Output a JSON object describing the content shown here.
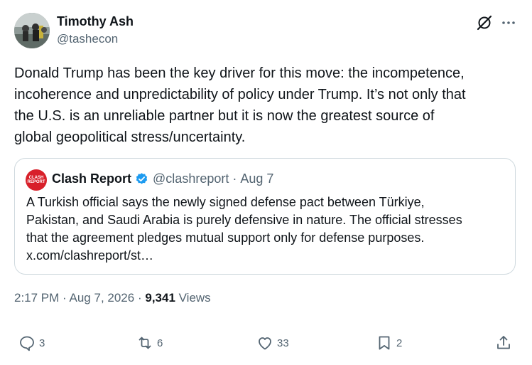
{
  "author": {
    "name": "Timothy Ash",
    "handle": "@tashecon"
  },
  "tweet": {
    "lines": [
      "Donald Trump has been the key driver for this move: the incompetence,",
      "incoherence and unpredictability of policy under Trump. It’s not only that",
      "the U.S. is an unreliable partner but it is now the greatest source of",
      "global geopolitical stress/uncertainty."
    ]
  },
  "quote": {
    "avatar_text": "CLASH REPORT",
    "name": "Clash Report",
    "handle": "@clashreport",
    "separator": "·",
    "date": "Aug 7",
    "lines": [
      "A Turkish official says the newly signed defense pact between Türkiye,",
      "Pakistan, and Saudi Arabia is purely defensive in nature.  The official stresses",
      "that the agreement pledges mutual support only for defense purposes.",
      "x.com/clashreport/st…"
    ]
  },
  "meta": {
    "time": "2:17 PM",
    "sep1": "·",
    "date": "Aug 7, 2026",
    "sep2": "·",
    "views_count": "9,341",
    "views_label": "Views"
  },
  "actions": {
    "replies": "3",
    "reposts": "6",
    "likes": "33",
    "bookmarks": "2"
  },
  "colors": {
    "text": "#0f1419",
    "secondary": "#536471",
    "border": "#cfd9de",
    "verified": "#1d9bf0",
    "clash_red": "#d8202a"
  },
  "icons": {
    "grok": "grok-icon",
    "more": "more-icon",
    "verified": "verified-badge-icon",
    "reply": "reply-icon",
    "repost": "repost-icon",
    "like": "like-icon",
    "bookmark": "bookmark-icon",
    "share": "share-icon"
  }
}
